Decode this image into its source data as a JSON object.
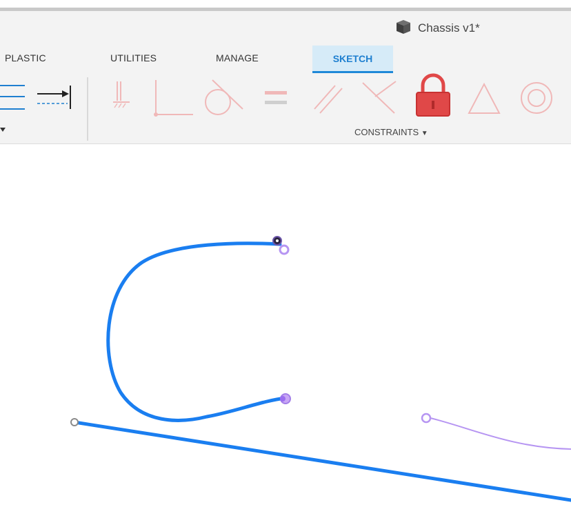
{
  "document": {
    "title": "Chassis v1*",
    "icon": "box-icon"
  },
  "tabs": [
    {
      "label": "PLASTIC",
      "active": false
    },
    {
      "label": "UTILITIES",
      "active": false
    },
    {
      "label": "MANAGE",
      "active": false
    },
    {
      "label": "SKETCH",
      "active": true
    }
  ],
  "toolbar": {
    "constraints_label": "CONSTRAINTS",
    "constraint_tools": [
      "fix-unfix-icon",
      "coincident-icon",
      "tangent-icon",
      "equal-icon",
      "parallel-icon",
      "perpendicular-icon",
      "lock-icon",
      "midpoint-icon",
      "concentric-icon"
    ],
    "sketch_tools": [
      "line-style-icon",
      "dimension-arrow-icon"
    ]
  },
  "colors": {
    "accent": "#1e88d8",
    "sketch_curve": "#1a7ef0",
    "construction_curve": "#b695f2",
    "lock_red": "#e04848",
    "disabled_icon": "#f0b8b8",
    "tab_active_bg": "#d6ebf8"
  }
}
